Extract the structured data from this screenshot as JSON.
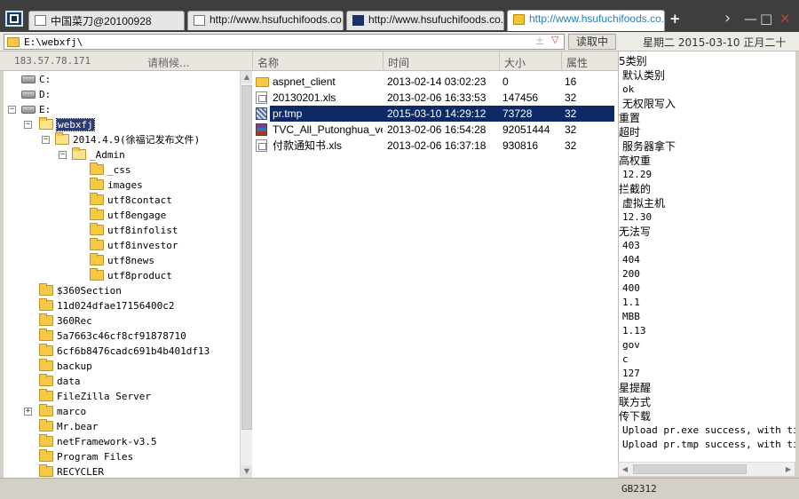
{
  "tabs": [
    {
      "label": "中国菜刀@20100928",
      "active": false
    },
    {
      "label": "http://www.hsufuchifoods.co...",
      "active": false
    },
    {
      "label": "http://www.hsufuchifoods.co...",
      "active": false
    },
    {
      "label": "http://www.hsufuchifoods.co...",
      "active": true
    }
  ],
  "window_buttons": {
    "new_tab": "+",
    "forward": "›",
    "minimize": "—",
    "maximize": "□",
    "close": "✕"
  },
  "address": {
    "path": "E:\\webxfj\\",
    "star": "±",
    "dropdown": "▽",
    "read_button": "读取中"
  },
  "datetime": "星期二 2015-03-10 正月二十",
  "left_header": {
    "ip": "183.57.78.171",
    "status": "请稍候..."
  },
  "columns": [
    "名称",
    "时间",
    "大小",
    "属性"
  ],
  "tree": [
    {
      "label": "C:",
      "kind": "drive",
      "level": 0
    },
    {
      "label": "D:",
      "kind": "drive",
      "level": 0
    },
    {
      "label": "E:",
      "kind": "drive",
      "level": 0,
      "expander": "−"
    },
    {
      "label": "webxfj",
      "kind": "folder",
      "level": 1,
      "expander": "−",
      "selected": true,
      "open": true
    },
    {
      "label": "2014.4.9(徐福记发布文件)",
      "kind": "folder",
      "level": 2,
      "expander": "−",
      "open": true
    },
    {
      "label": "_Admin",
      "kind": "folder",
      "level": 3,
      "expander": "−",
      "open": true
    },
    {
      "label": "_css",
      "kind": "folder",
      "level": 4
    },
    {
      "label": "images",
      "kind": "folder",
      "level": 4
    },
    {
      "label": "utf8contact",
      "kind": "folder",
      "level": 4
    },
    {
      "label": "utf8engage",
      "kind": "folder",
      "level": 4
    },
    {
      "label": "utf8infolist",
      "kind": "folder",
      "level": 4
    },
    {
      "label": "utf8investor",
      "kind": "folder",
      "level": 4
    },
    {
      "label": "utf8news",
      "kind": "folder",
      "level": 4
    },
    {
      "label": "utf8product",
      "kind": "folder",
      "level": 4
    },
    {
      "label": "$360Section",
      "kind": "folder",
      "level": 1
    },
    {
      "label": "11d024dfae17156400c2",
      "kind": "folder",
      "level": 1
    },
    {
      "label": "360Rec",
      "kind": "folder",
      "level": 1
    },
    {
      "label": "5a7663c46cf8cf91878710",
      "kind": "folder",
      "level": 1
    },
    {
      "label": "6cf6b8476cadc691b4b401df13",
      "kind": "folder",
      "level": 1
    },
    {
      "label": "backup",
      "kind": "folder",
      "level": 1
    },
    {
      "label": "data",
      "kind": "folder",
      "level": 1
    },
    {
      "label": "FileZilla Server",
      "kind": "folder",
      "level": 1
    },
    {
      "label": "marco",
      "kind": "folder",
      "level": 1,
      "expander": "+"
    },
    {
      "label": "Mr.bear",
      "kind": "folder",
      "level": 1
    },
    {
      "label": "netFramework-v3.5",
      "kind": "folder",
      "level": 1
    },
    {
      "label": "Program Files",
      "kind": "folder",
      "level": 1
    },
    {
      "label": "RECYCLER",
      "kind": "folder",
      "level": 1
    }
  ],
  "files": [
    {
      "name": "aspnet_client",
      "time": "2013-02-14 03:02:23",
      "size": "0",
      "attr": "16",
      "type": "folder"
    },
    {
      "name": "20130201.xls",
      "time": "2013-02-06 16:33:53",
      "size": "147456",
      "attr": "32",
      "type": "xls"
    },
    {
      "name": "pr.tmp",
      "time": "2015-03-10 14:29:12",
      "size": "73728",
      "attr": "32",
      "type": "tmp",
      "selected": true
    },
    {
      "name": "TVC_All_Putonghua_ver...",
      "time": "2013-02-06 16:54:28",
      "size": "92051444",
      "attr": "32",
      "type": "rar"
    },
    {
      "name": "付款通知书.xls",
      "time": "2013-02-06 16:37:18",
      "size": "930816",
      "attr": "32",
      "type": "xls"
    }
  ],
  "right_panel": [
    {
      "text": "5类别",
      "mono": false
    },
    {
      "text": "默认类别",
      "mono": false
    },
    {
      "text": "ok",
      "mono": true
    },
    {
      "text": "无权限写入",
      "mono": false
    },
    {
      "text": "重置",
      "mono": false
    },
    {
      "text": "超时",
      "mono": false
    },
    {
      "text": "服务器拿下",
      "mono": false
    },
    {
      "text": "高权重",
      "mono": false
    },
    {
      "text": "12.29",
      "mono": true
    },
    {
      "text": "拦截的",
      "mono": false
    },
    {
      "text": "虚拟主机",
      "mono": false
    },
    {
      "text": "12.30",
      "mono": true
    },
    {
      "text": "无法写",
      "mono": false
    },
    {
      "text": "403",
      "mono": true
    },
    {
      "text": "404",
      "mono": true
    },
    {
      "text": "200",
      "mono": true
    },
    {
      "text": "400",
      "mono": true
    },
    {
      "text": "1.1",
      "mono": true
    },
    {
      "text": "MBB",
      "mono": true
    },
    {
      "text": "1.13",
      "mono": true
    },
    {
      "text": "gov",
      "mono": true
    },
    {
      "text": "c",
      "mono": true
    },
    {
      "text": "127",
      "mono": true
    },
    {
      "text": "星提醒",
      "mono": false
    },
    {
      "text": "联方式",
      "mono": false
    },
    {
      "text": "传下载",
      "mono": false
    },
    {
      "text": "Upload pr.exe success, with time",
      "mono": true
    },
    {
      "text": "Upload pr.tmp success, with time",
      "mono": true
    }
  ],
  "encoding": "GB2312",
  "colors": {
    "selection": "#0d2a66",
    "tree_selection": "#2c3c73",
    "active_tab_text": "#1f7fc0",
    "close_button": "#d33b2b"
  }
}
